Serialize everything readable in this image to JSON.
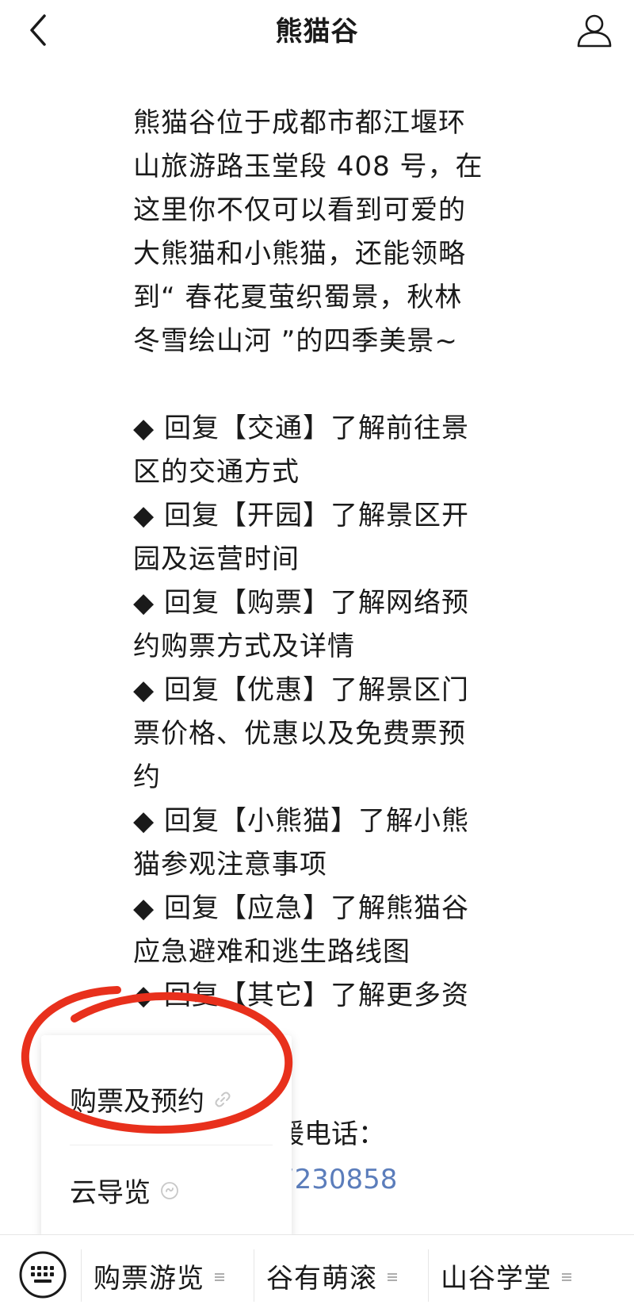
{
  "header": {
    "title": "熊猫谷",
    "back_icon": "chevron-left-icon",
    "profile_icon": "user-icon"
  },
  "message": {
    "intro_lines": [
      "熊猫谷位于成都市都江堰环",
      "山旅游路玉堂段 408 号，在",
      "这里你不仅可以看到可爱的",
      "大熊猫和小熊猫，还能领略",
      "到“ 春花夏萤织蜀景，秋林",
      "冬雪绘山河 ”的四季美景~"
    ],
    "menu_lines": [
      "◆ 回复【交通】了解前往景",
      "区的交通方式",
      "◆ 回复【开园】了解景区开",
      "园及运营时间",
      "◆ 回复【购票】了解网络预",
      "约购票方式及详情",
      "◆ 回复【优惠】了解景区门",
      "票价格、优惠以及免费票预",
      "约",
      "◆ 回复【小熊猫】了解小熊",
      "猫参观注意事项",
      "◆ 回复【应急】了解熊猫谷",
      "应急避难和逃生路线图",
      "◆ 回复【其它】了解更多资"
    ],
    "rescue_text": "援电话：",
    "phone_fragment": "7230858"
  },
  "popup": {
    "items": [
      {
        "label": "购票及预约",
        "icon": "link-icon"
      },
      {
        "label": "云导览",
        "icon": "mini-program-icon"
      }
    ]
  },
  "bottom_bar": {
    "keyboard_icon": "keyboard-icon",
    "tabs": [
      {
        "label": "购票游览",
        "icon": "menu-lines-icon"
      },
      {
        "label": "谷有萌滚",
        "icon": "menu-lines-icon"
      },
      {
        "label": "山谷学堂",
        "icon": "menu-lines-icon"
      }
    ]
  },
  "colors": {
    "annotation": "#e8301c",
    "link_blue": "#5b7dbb",
    "divider": "#e6e6e6"
  }
}
